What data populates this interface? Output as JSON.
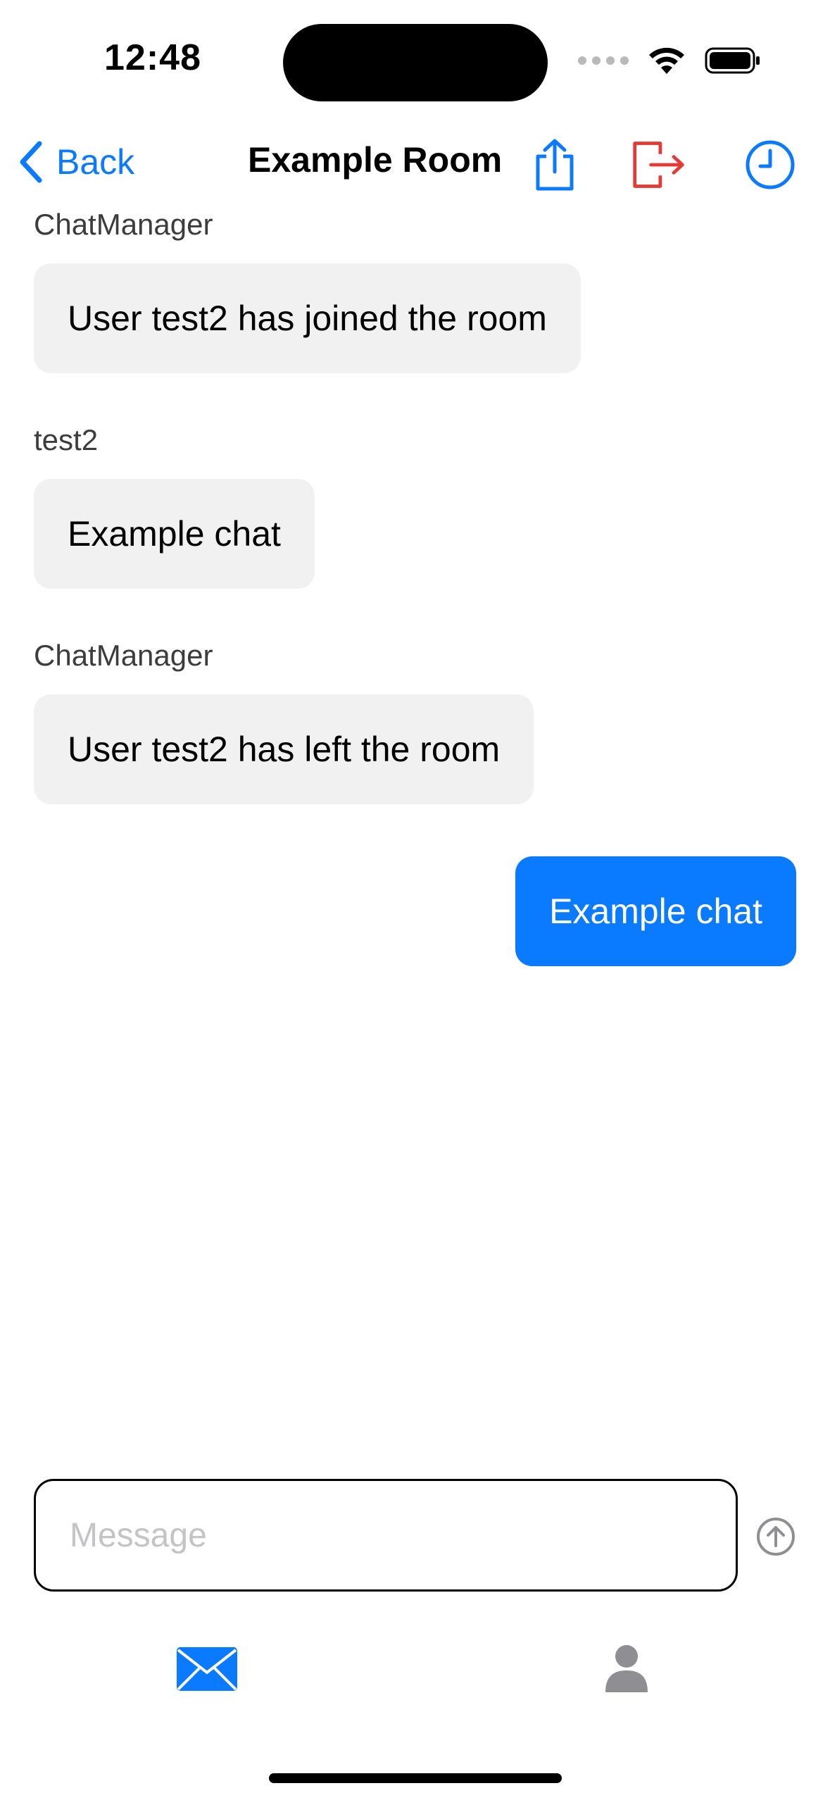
{
  "status_bar": {
    "time": "12:48"
  },
  "nav": {
    "back_label": "Back",
    "title": "Example Room",
    "accent_color": "#0a7aff",
    "leave_color": "#e53935",
    "icons": [
      "share-icon",
      "leave-room-icon",
      "history-clock-icon"
    ]
  },
  "messages": [
    {
      "sender": "ChatManager",
      "text": "User test2 has joined the room",
      "direction": "incoming"
    },
    {
      "sender": "test2",
      "text": "Example chat",
      "direction": "incoming"
    },
    {
      "sender": "ChatManager",
      "text": "User test2 has left the room",
      "direction": "incoming"
    },
    {
      "sender": "",
      "text": "Example chat",
      "direction": "outgoing"
    }
  ],
  "composer": {
    "placeholder": "Message",
    "value": ""
  },
  "tab_bar": {
    "items": [
      {
        "icon": "envelope-icon",
        "selected": true
      },
      {
        "icon": "person-icon",
        "selected": false
      }
    ]
  }
}
